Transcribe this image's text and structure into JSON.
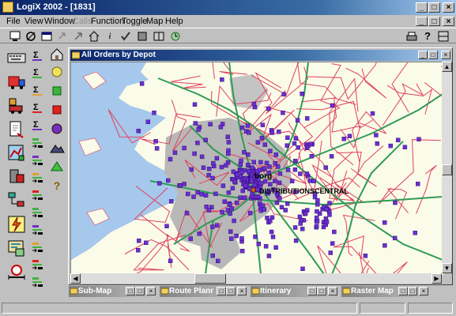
{
  "window": {
    "title": "LogiX 2002 - [1831]"
  },
  "menu": [
    {
      "label": "File",
      "enabled": true
    },
    {
      "label": "View",
      "enabled": true
    },
    {
      "label": "Window",
      "enabled": true
    },
    {
      "label": "Calls",
      "enabled": false
    },
    {
      "label": "Function",
      "enabled": true
    },
    {
      "label": "Toggle",
      "enabled": true
    },
    {
      "label": "Map",
      "enabled": true
    },
    {
      "label": "Help",
      "enabled": true
    }
  ],
  "toolbar": {
    "left": [
      "monitor-icon",
      "connect-icon",
      "window-icon",
      "calls-icon",
      "arrow-icon",
      "home-icon",
      "info-icon",
      "check-icon",
      "stop-icon",
      "split-icon",
      "refresh-icon"
    ],
    "right": [
      "print-icon",
      "help-icon",
      "window-arrange-icon"
    ]
  },
  "map_window": {
    "title": "All Orders by Depot",
    "labels": {
      "city": "borg",
      "depot": "DISTRIBUTIONSCENTRAL"
    }
  },
  "minimized_windows": [
    {
      "title": "Sub-Map"
    },
    {
      "title": "Route Planni"
    },
    {
      "title": "Itinerary"
    },
    {
      "title": "Raster Map"
    }
  ],
  "colors": {
    "order_marker": "#6a2fd0",
    "road_green": "#2f9b55",
    "road_red": "#e04060",
    "water": "#a6c8ec",
    "land": "#fbfbe9",
    "urban": "#b8b8b8"
  }
}
